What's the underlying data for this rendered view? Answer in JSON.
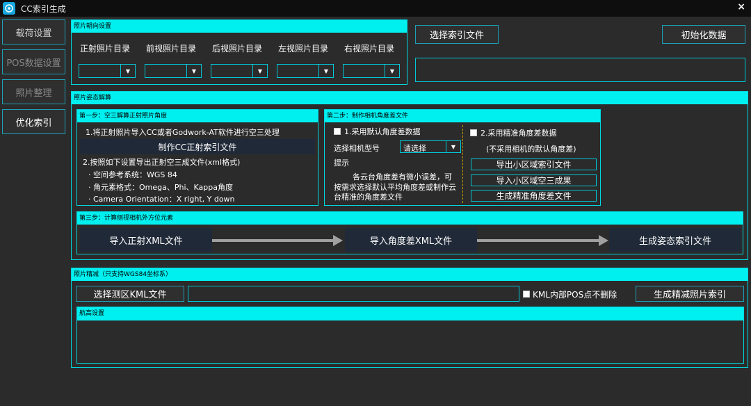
{
  "window": {
    "title": "CC索引生成",
    "close_glyph": "×"
  },
  "nav": {
    "items": [
      {
        "label": "载荷设置"
      },
      {
        "label": "POS数据设置"
      },
      {
        "label": "照片整理"
      },
      {
        "label": "优化索引"
      }
    ]
  },
  "orientation": {
    "title": "照片朝向设置",
    "dirs": [
      "正射照片目录",
      "前视照片目录",
      "后视照片目录",
      "左视照片目录",
      "右视照片目录"
    ]
  },
  "top_actions": {
    "select_index": "选择索引文件",
    "init_data": "初始化数据"
  },
  "attitude": {
    "title": "照片姿态解算",
    "step1": {
      "title": "第一步：空三解算正射照片角度",
      "line1": "1.将正射照片导入CC或者Godwork-AT软件进行空三处理",
      "make_btn": "制作CC正射索引文件",
      "line2": "2.按照如下设置导出正射空三成文件(xml格式)",
      "bullets": [
        "· 空间参考系统：WGS 84",
        "· 角元素格式：Omega、Phi、Kappa角度",
        "· Camera Orientation：X right, Y down"
      ]
    },
    "step2": {
      "title": "第二步：制作相机角度差文件",
      "opt1": "1.采用默认角度差数据",
      "camera_label": "选择相机型号",
      "camera_select": "请选择",
      "hint_label": "提示",
      "hint_text": [
        "各云台角度差有微小误差，可",
        "按需求选择默认平均角度差或制作云",
        "台精准的角度差文件"
      ],
      "opt2": "2.采用精准角度差数据",
      "opt2_note": "(不采用相机的默认角度差)",
      "btn_export": "导出小区域索引文件",
      "btn_import": "导入小区域空三成果",
      "btn_generate": "生成精准角度差文件"
    },
    "step3": {
      "title": "第三步：计算侧视相机外方位元素",
      "btn1": "导入正射XML文件",
      "btn2": "导入角度差XML文件",
      "btn3": "生成姿态索引文件"
    }
  },
  "refine": {
    "title": "照片精减（只支持WGS84坐标系）",
    "select_kml": "选择测区KML文件",
    "keep_inside": "KML内部POS点不删除",
    "generate": "生成精减照片索引",
    "altitude_title": "航高设置"
  },
  "colors": {
    "accent": "#00f0f0",
    "border": "#00c8d8",
    "background": "#2b2b2b"
  }
}
